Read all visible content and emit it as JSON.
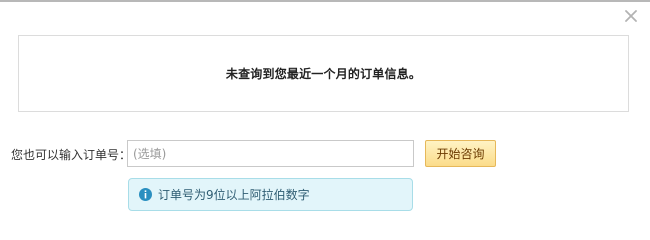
{
  "dialog": {
    "close_icon": "close-icon",
    "notice": {
      "text": "未查询到您最近一个月的订单信息。"
    },
    "order_form": {
      "label": "您也可以输入订单号：",
      "input_value": "",
      "input_placeholder": "(选填)",
      "submit_label": "开始咨询"
    },
    "hint": {
      "icon": "info-icon",
      "text": "订单号为9位以上阿拉伯数字"
    }
  },
  "colors": {
    "button_border": "#e6b85a",
    "button_fill": "#fbdc8a",
    "hint_border": "#a8dde8",
    "hint_fill": "#e2f5fa",
    "info_icon": "#2a8fc0"
  }
}
